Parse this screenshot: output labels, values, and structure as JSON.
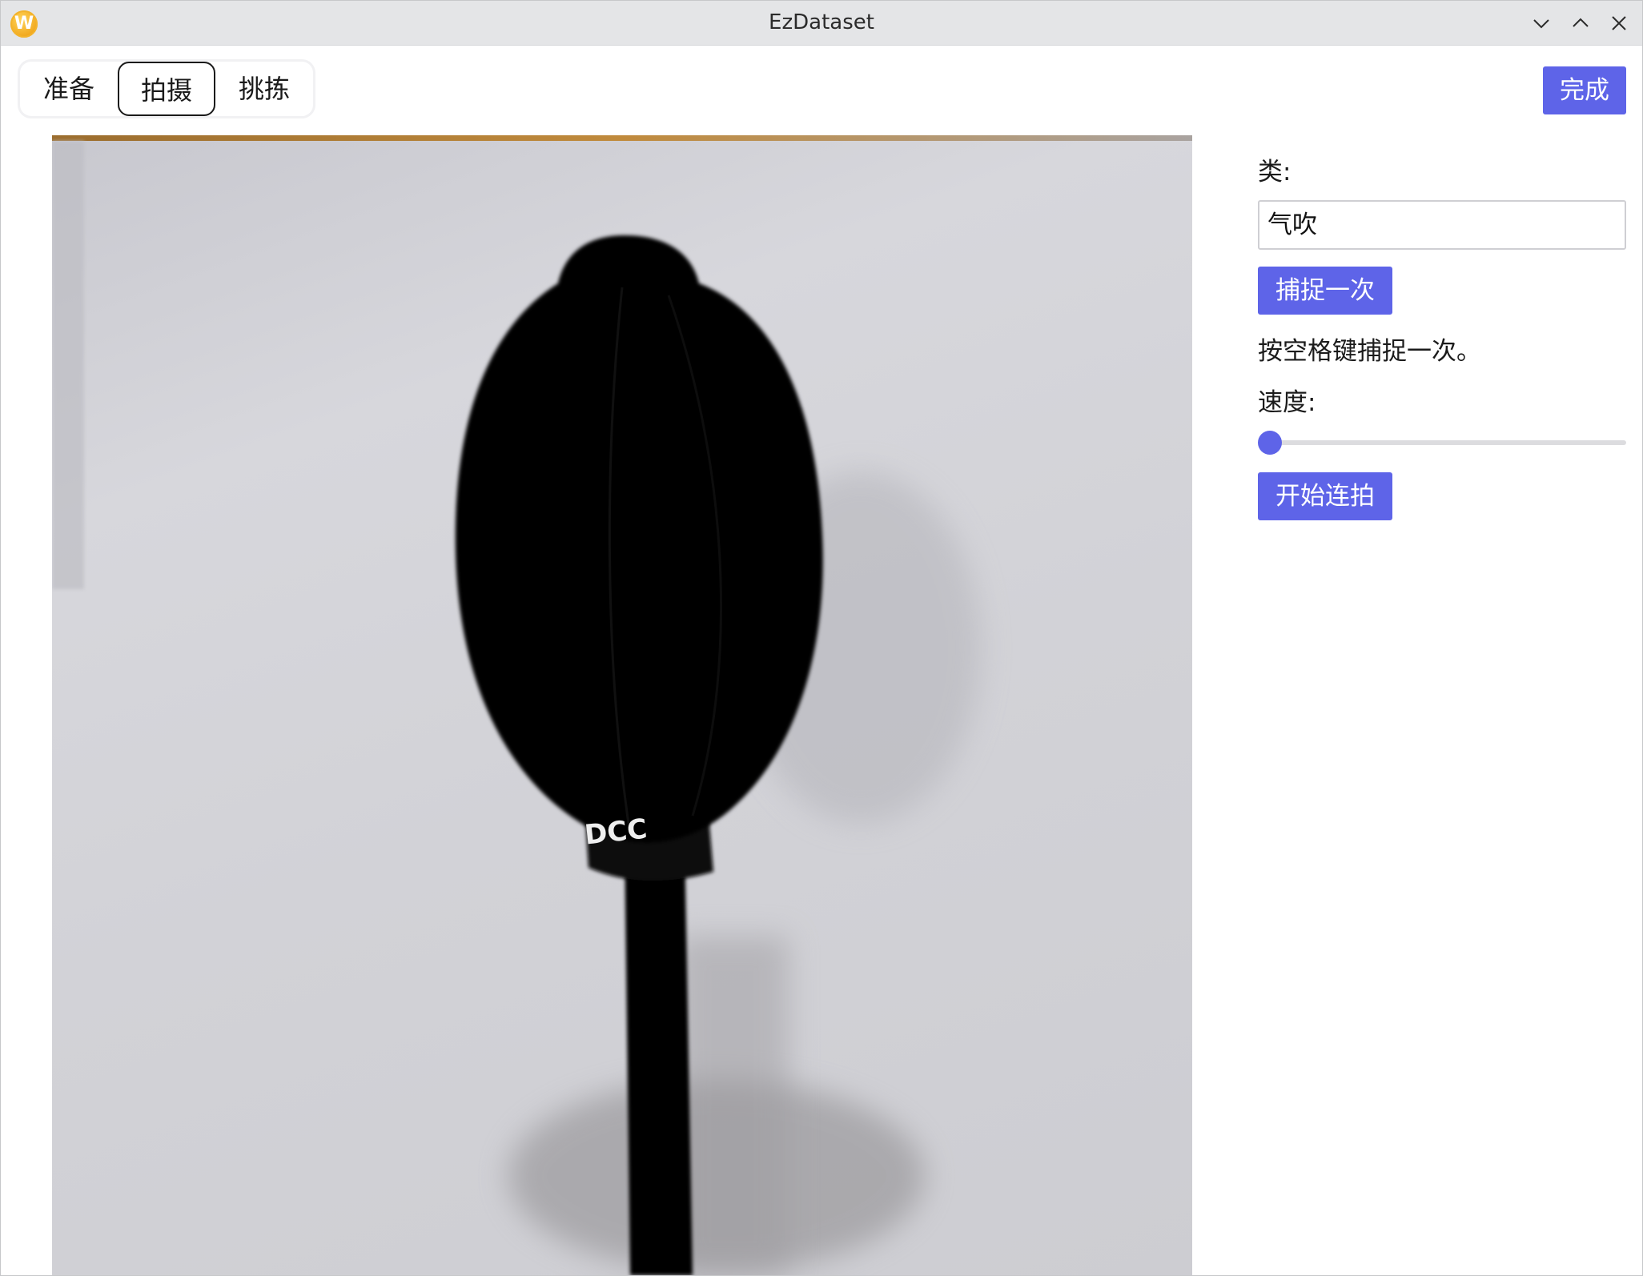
{
  "window": {
    "title": "EzDataset",
    "logo_letter": "W",
    "logo_icon": "app-logo-icon",
    "controls": [
      "chevron-down-icon",
      "chevron-up-icon",
      "close-icon"
    ]
  },
  "tabs": [
    {
      "label": "准备",
      "active": false
    },
    {
      "label": "拍摄",
      "active": true
    },
    {
      "label": "挑拣",
      "active": false
    }
  ],
  "toolbar": {
    "done_label": "完成"
  },
  "preview": {
    "overlay_text": "DCC"
  },
  "panel": {
    "class_label": "类:",
    "class_value": "气吹",
    "capture_label": "捕捉一次",
    "hint": "按空格键捕捉一次。",
    "speed_label": "速度:",
    "speed_value": 0,
    "burst_label": "开始连拍"
  },
  "colors": {
    "accent": "#5e64e8",
    "titlebar": "#e4e5e7"
  }
}
